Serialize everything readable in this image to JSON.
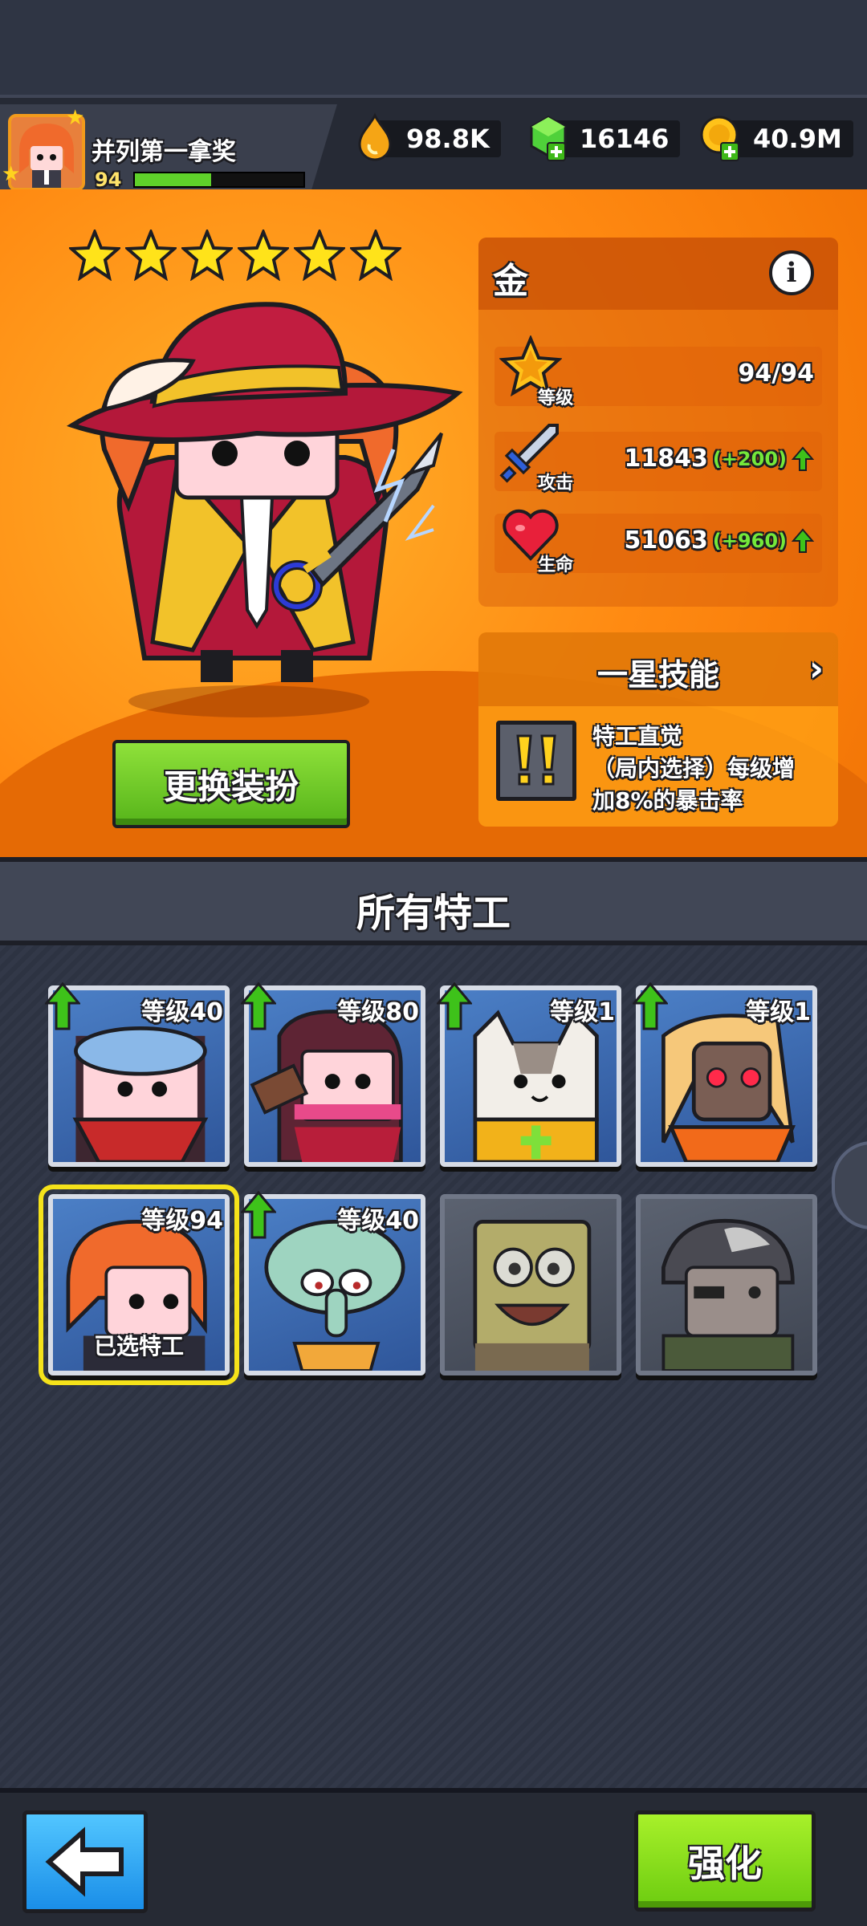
{
  "player": {
    "name": "并列第一拿奖",
    "level": "94",
    "xp_progress": 0.45
  },
  "currencies": [
    {
      "icon": "flame-drop-icon",
      "value": "98.8K"
    },
    {
      "icon": "green-gem-plus-icon",
      "value": "16146"
    },
    {
      "icon": "gold-coin-plus-icon",
      "value": "40.9M"
    }
  ],
  "hero": {
    "star_count": 6,
    "rarity": "金",
    "stats": [
      {
        "icon": "level-star-icon",
        "label": "等级",
        "value": "94/94",
        "bonus": ""
      },
      {
        "icon": "sword-icon",
        "label": "攻击",
        "value": "11843",
        "bonus": "(+200)"
      },
      {
        "icon": "heart-icon",
        "label": "生命",
        "value": "51063",
        "bonus": "(+960)"
      }
    ],
    "skill": {
      "title": "一星技能",
      "name": "特工直觉",
      "desc_line2": "（局内选择）每级增",
      "desc_line3": "加8%的暴击率"
    },
    "outfit_button": "更换装扮"
  },
  "section_title": "所有特工",
  "agents": [
    {
      "level": "等级40",
      "upgrade": true,
      "locked": false,
      "selected": false,
      "portrait": "goggles-masked-agent"
    },
    {
      "level": "等级80",
      "upgrade": true,
      "locked": false,
      "selected": false,
      "portrait": "pink-ninja-agent"
    },
    {
      "level": "等级1",
      "upgrade": true,
      "locked": false,
      "selected": false,
      "portrait": "cat-agent"
    },
    {
      "level": "等级1",
      "upgrade": true,
      "locked": false,
      "selected": false,
      "portrait": "robot-blonde-agent"
    },
    {
      "level": "等级94",
      "upgrade": false,
      "locked": false,
      "selected": true,
      "tag": "已选特工",
      "portrait": "red-hair-musketeer-agent"
    },
    {
      "level": "等级40",
      "upgrade": true,
      "locked": false,
      "selected": false,
      "portrait": "squid-agent"
    },
    {
      "level": "",
      "upgrade": false,
      "locked": true,
      "selected": false,
      "portrait": "sponge-agent"
    },
    {
      "level": "",
      "upgrade": false,
      "locked": true,
      "selected": false,
      "portrait": "eyepatch-agent"
    }
  ],
  "bottom": {
    "enhance_label": "强化"
  },
  "colors": {
    "hero_bg": "#ff8a12",
    "accent_green": "#74e83a",
    "selected_border": "#f5e21a"
  }
}
